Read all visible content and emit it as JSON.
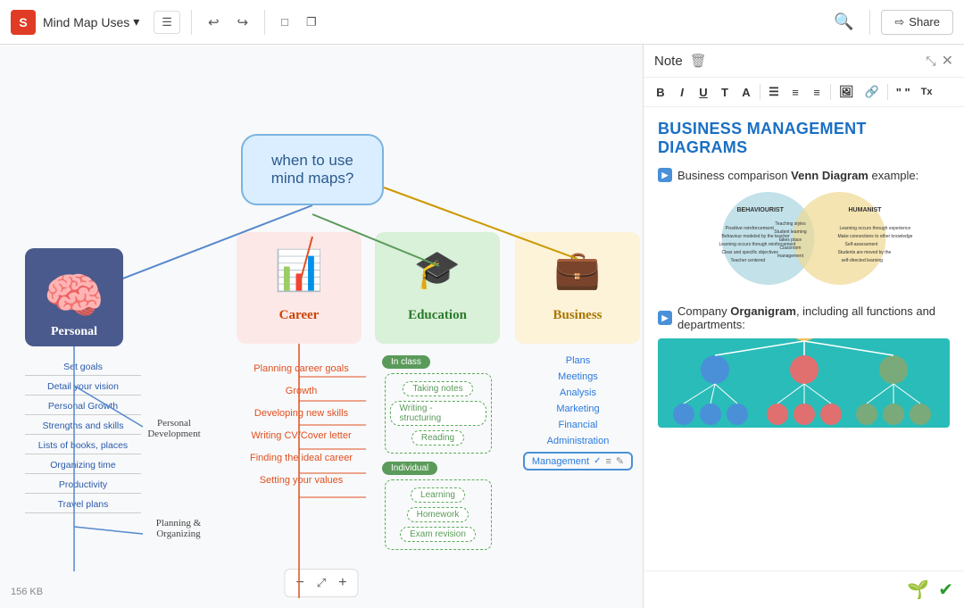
{
  "toolbar": {
    "logo": "S",
    "title": "Mind Map Uses",
    "menu_icon": "☰",
    "undo_label": "↩",
    "redo_label": "↪",
    "frame_label": "⬜",
    "clone_label": "❐",
    "search_label": "🔍",
    "share_label": "Share"
  },
  "canvas": {
    "central_node": "when to use\nmind maps?",
    "zoom_minus": "−",
    "zoom_fit": "⤢",
    "zoom_plus": "+",
    "file_size": "156 KB"
  },
  "personal": {
    "label": "Personal",
    "subs": [
      "Set goals",
      "Detail your vision",
      "Personal Growth",
      "Strengths and skills",
      "Lists of books, places",
      "Organizing time",
      "Productivity",
      "Travel plans"
    ],
    "pd_label": "Personal\nDevelopment",
    "planning_label": "Planning &\nOrganizing"
  },
  "career": {
    "label": "Career",
    "subs": [
      "Planning career goals",
      "Growth",
      "Developing new skills",
      "Writing CV/Cover letter",
      "Finding the ideal career",
      "Setting your values"
    ]
  },
  "education": {
    "label": "Education",
    "in_class_label": "In class",
    "in_class_subs": [
      "Taking notes",
      "Writing - structuring",
      "Reading"
    ],
    "individual_label": "Individual",
    "individual_subs": [
      "Learning",
      "Homework",
      "Exam revision"
    ]
  },
  "business": {
    "label": "Business",
    "subs": [
      "Plans",
      "Meetings",
      "Analysis",
      "Marketing",
      "Financial",
      "Administration",
      "Management"
    ]
  },
  "note": {
    "title": "Note",
    "toolbar_buttons": [
      "B",
      "I",
      "U",
      "T",
      "A",
      "≡",
      "≡",
      "≡",
      "🖼",
      "🔗",
      "\"\"",
      "Tx"
    ],
    "content_title": "BUSINESS MANAGEMENT DIAGRAMS",
    "section1_icon": "▶",
    "section1_text_before": "Business comparison",
    "section1_bold": " Venn Diagram",
    "section1_text_after": " example:",
    "venn_left_label": "BEHAVIOURIST",
    "venn_right_label": "HUMANIST",
    "section2_icon": "▶",
    "section2_text_before": "Company ",
    "section2_bold": "Organigram",
    "section2_text_after": ", including all functions and departments:"
  }
}
